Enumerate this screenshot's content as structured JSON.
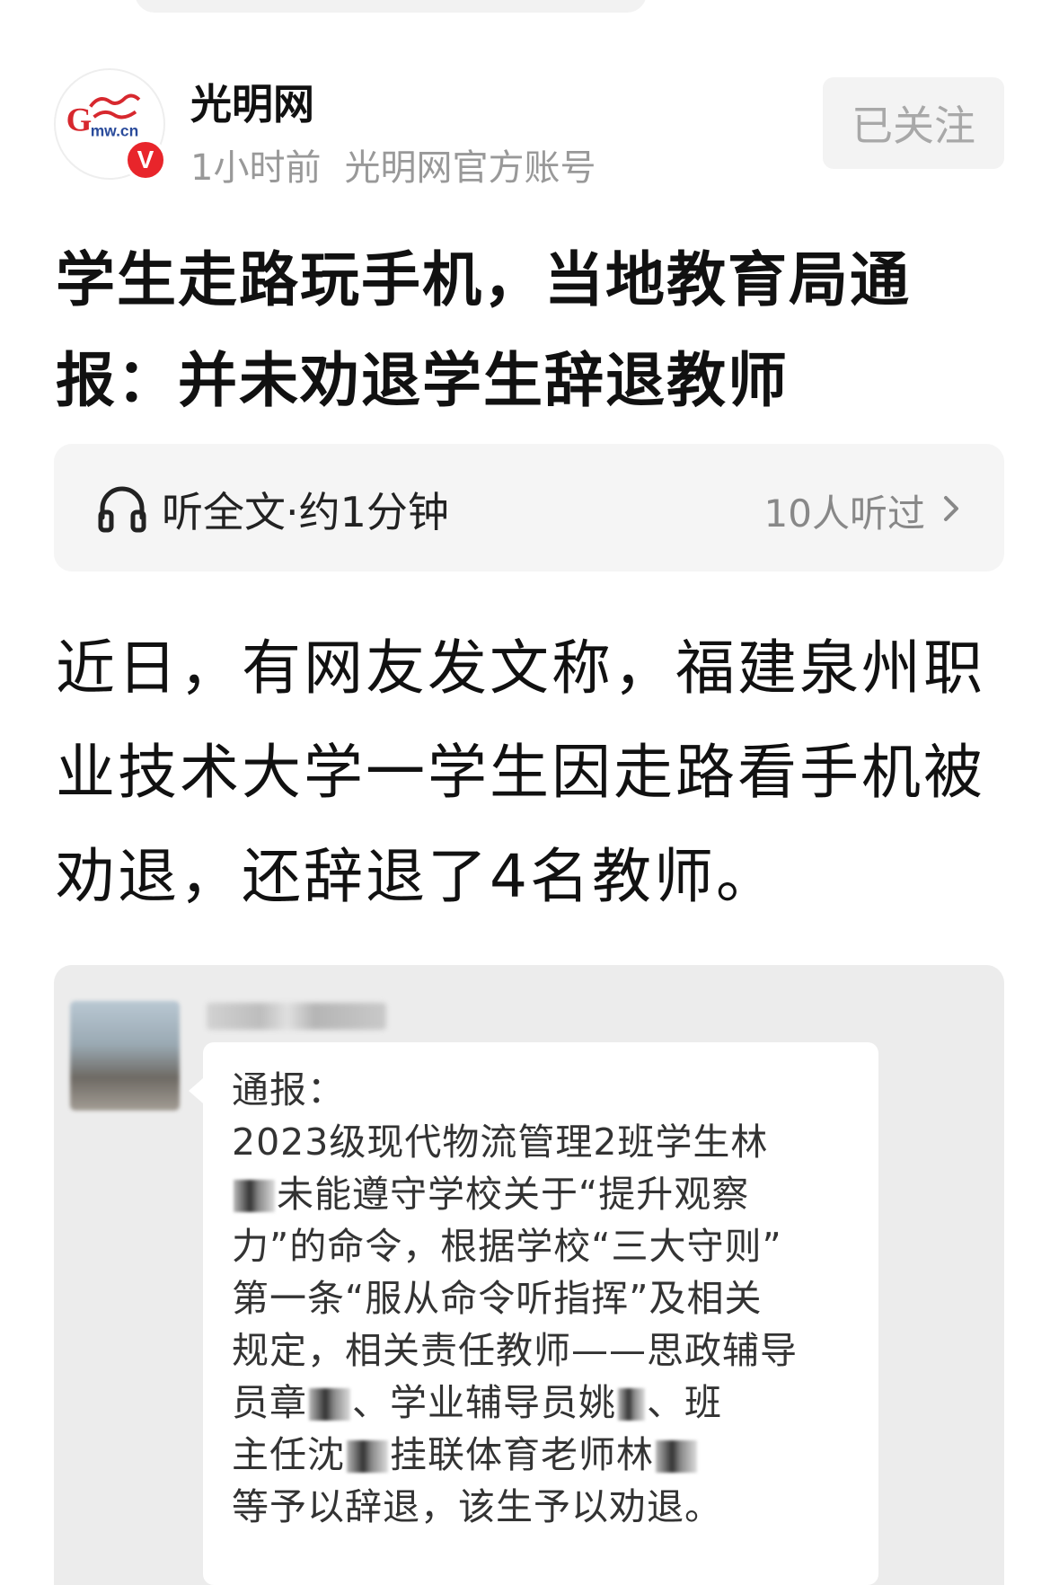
{
  "header": {
    "author_name": "光明网",
    "time_ago": "1小时前",
    "account_type": "光明网官方账号",
    "follow_label": "已关注",
    "verified_badge": "V",
    "logo_text": "G mw.cn"
  },
  "article": {
    "title": "学生走路玩手机，当地教育局通报：并未劝退学生辞退教师",
    "paragraph": "近日，有网友发文称，福建泉州职业技术大学一学生因走路看手机被劝退，还辞退了4名教师。"
  },
  "listen": {
    "label": "听全文·约1分钟",
    "count": "10人听过"
  },
  "screenshot": {
    "notice_lines": [
      "通报：",
      "2023级现代物流管理2班学生林",
      "未能遵守学校关于“提升观察",
      "力”的命令，根据学校“三大守则”",
      "第一条“服从命令听指挥”及相关",
      "规定，相关责任教师——思政辅导",
      "员章",
      "、学业辅导员姚",
      "、班",
      "主任沈",
      "挂联体育老师林",
      "等予以辞退，该生予以劝退。"
    ]
  },
  "colors": {
    "accent_red": "#e8252b",
    "meta_gray": "#999999",
    "card_bg": "#f5f5f5"
  }
}
